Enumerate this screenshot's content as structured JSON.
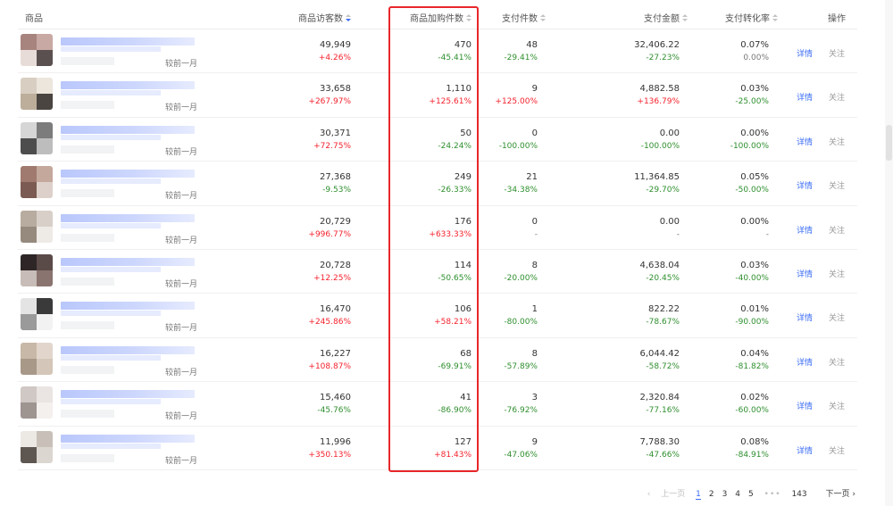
{
  "header": {
    "product": "商品",
    "visitors": "商品访客数",
    "cart_adds": "商品加购件数",
    "pay_items": "支付件数",
    "pay_amount": "支付金额",
    "conversion": "支付转化率",
    "actions": "操作"
  },
  "compare_label": "较前一月",
  "row_actions": {
    "detail": "详情",
    "follow": "关注"
  },
  "rows": [
    {
      "visitors": "49,949",
      "visitors_delta": "+4.26%",
      "cart": "470",
      "cart_delta": "-45.41%",
      "paid": "48",
      "paid_delta": "-29.41%",
      "amount": "32,406.22",
      "amount_delta": "-27.23%",
      "rate": "0.07%",
      "rate_delta": "0.00%",
      "thumb": [
        "#a8847e",
        "#c9a9a3",
        "#e8dcd8",
        "#5b5050"
      ]
    },
    {
      "visitors": "33,658",
      "visitors_delta": "+267.97%",
      "cart": "1,110",
      "cart_delta": "+125.61%",
      "paid": "9",
      "paid_delta": "+125.00%",
      "amount": "4,882.58",
      "amount_delta": "+136.79%",
      "rate": "0.03%",
      "rate_delta": "-25.00%",
      "thumb": [
        "#d8cfc2",
        "#ece6dc",
        "#bcae9a",
        "#4a4540"
      ]
    },
    {
      "visitors": "30,371",
      "visitors_delta": "+72.75%",
      "cart": "50",
      "cart_delta": "-24.24%",
      "paid": "0",
      "paid_delta": "-100.00%",
      "amount": "0.00",
      "amount_delta": "-100.00%",
      "rate": "0.00%",
      "rate_delta": "-100.00%",
      "thumb": [
        "#d6d6d6",
        "#7c7c7c",
        "#4d4d4d",
        "#bdbdbd"
      ]
    },
    {
      "visitors": "27,368",
      "visitors_delta": "-9.53%",
      "cart": "249",
      "cart_delta": "-26.33%",
      "paid": "21",
      "paid_delta": "-34.38%",
      "amount": "11,364.85",
      "amount_delta": "-29.70%",
      "rate": "0.05%",
      "rate_delta": "-50.00%",
      "thumb": [
        "#a07a6e",
        "#c4a89c",
        "#7a5a52",
        "#ddd0ca"
      ]
    },
    {
      "visitors": "20,729",
      "visitors_delta": "+996.77%",
      "cart": "176",
      "cart_delta": "+633.33%",
      "paid": "0",
      "paid_delta": "-",
      "amount": "0.00",
      "amount_delta": "-",
      "rate": "0.00%",
      "rate_delta": "-",
      "thumb": [
        "#b8aca0",
        "#d8d0c8",
        "#968a7e",
        "#eeeae6"
      ]
    },
    {
      "visitors": "20,728",
      "visitors_delta": "+12.25%",
      "cart": "114",
      "cart_delta": "-50.65%",
      "paid": "8",
      "paid_delta": "-20.00%",
      "amount": "4,638.04",
      "amount_delta": "-20.45%",
      "rate": "0.03%",
      "rate_delta": "-40.00%",
      "thumb": [
        "#2e2626",
        "#5a4a48",
        "#c8bcb8",
        "#8a7470"
      ]
    },
    {
      "visitors": "16,470",
      "visitors_delta": "+245.86%",
      "cart": "106",
      "cart_delta": "+58.21%",
      "paid": "1",
      "paid_delta": "-80.00%",
      "amount": "822.22",
      "amount_delta": "-78.67%",
      "rate": "0.01%",
      "rate_delta": "-90.00%",
      "thumb": [
        "#e4e4e4",
        "#3a3a3a",
        "#9a9a9a",
        "#f2f2f2"
      ]
    },
    {
      "visitors": "16,227",
      "visitors_delta": "+108.87%",
      "cart": "68",
      "cart_delta": "-69.91%",
      "paid": "8",
      "paid_delta": "-57.89%",
      "amount": "6,044.42",
      "amount_delta": "-58.72%",
      "rate": "0.04%",
      "rate_delta": "-81.82%",
      "thumb": [
        "#c8b8a8",
        "#e2d6cc",
        "#a89888",
        "#d4c6b8"
      ]
    },
    {
      "visitors": "15,460",
      "visitors_delta": "-45.76%",
      "cart": "41",
      "cart_delta": "-86.90%",
      "paid": "3",
      "paid_delta": "-76.92%",
      "amount": "2,320.84",
      "amount_delta": "-77.16%",
      "rate": "0.02%",
      "rate_delta": "-60.00%",
      "thumb": [
        "#d0c8c4",
        "#eae4e2",
        "#9e9490",
        "#f4f0ee"
      ]
    },
    {
      "visitors": "11,996",
      "visitors_delta": "+350.13%",
      "cart": "127",
      "cart_delta": "+81.43%",
      "paid": "9",
      "paid_delta": "-47.06%",
      "amount": "7,788.30",
      "amount_delta": "-47.66%",
      "rate": "0.08%",
      "rate_delta": "-84.91%",
      "thumb": [
        "#ece8e4",
        "#c8c0b8",
        "#5e5650",
        "#dcd6d0"
      ]
    }
  ],
  "pager": {
    "prev": "上一页",
    "pages": [
      "1",
      "2",
      "3",
      "4",
      "5"
    ],
    "current": "1",
    "ellipsis": "•••",
    "last": "143",
    "next": "下一页"
  }
}
